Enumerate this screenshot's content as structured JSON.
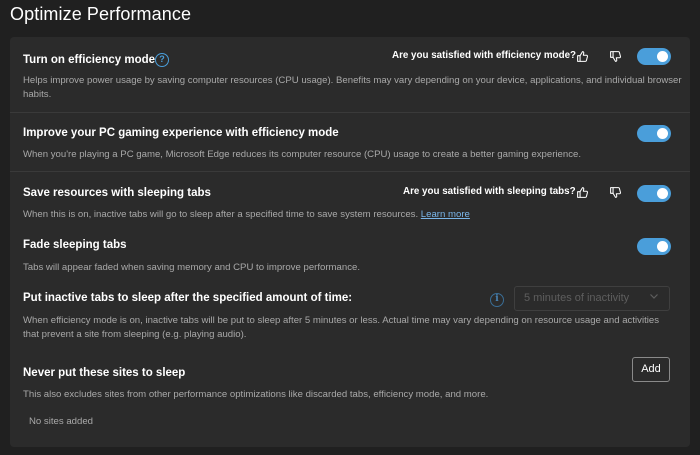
{
  "page": {
    "title": "Optimize Performance"
  },
  "efficiency": {
    "title": "Turn on efficiency mode",
    "feedback": "Are you satisfied with efficiency mode?",
    "desc": "Helps improve power usage by saving computer resources (CPU usage). Benefits may vary depending on your device, applications, and individual browser habits.",
    "enabled": true
  },
  "gaming": {
    "title": "Improve your PC gaming experience with efficiency mode",
    "desc": "When you're playing a PC game, Microsoft Edge reduces its computer resource (CPU) usage to create a better gaming experience.",
    "enabled": true
  },
  "sleeping": {
    "title": "Save resources with sleeping tabs",
    "feedback": "Are you satisfied with sleeping tabs?",
    "desc": "When this is on, inactive tabs will go to sleep after a specified time to save system resources.",
    "learn_more": "Learn more",
    "enabled": true
  },
  "fade": {
    "title": "Fade sleeping tabs",
    "desc": "Tabs will appear faded when saving memory and CPU to improve performance.",
    "enabled": true
  },
  "inactive": {
    "title": "Put inactive tabs to sleep after the specified amount of time:",
    "selected": "5 minutes of inactivity",
    "desc": "When efficiency mode is on, inactive tabs will be put to sleep after 5 minutes or less. Actual time may vary depending on resource usage and activities that prevent a site from sleeping (e.g. playing audio)."
  },
  "never_sleep": {
    "title": "Never put these sites to sleep",
    "add_label": "Add",
    "desc": "This also excludes sites from other performance optimizations like discarded tabs, efficiency mode, and more.",
    "empty": "No sites added"
  },
  "colors": {
    "accent": "#4a9eda",
    "background": "#202020",
    "card": "#2b2b2b"
  },
  "icons": {
    "help": "question-circle-icon",
    "like": "thumbs-up-icon",
    "dislike": "thumbs-down-icon",
    "info": "info-circle-icon",
    "chevron": "chevron-down-icon"
  }
}
